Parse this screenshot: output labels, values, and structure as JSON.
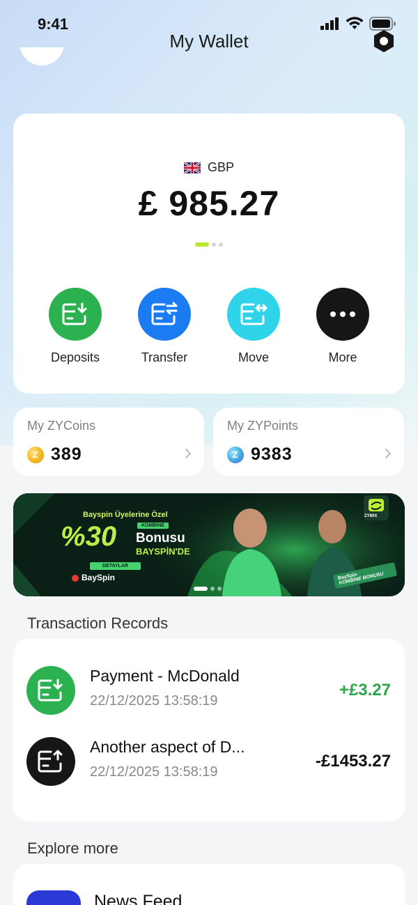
{
  "status_bar": {
    "time": "9:41"
  },
  "header": {
    "title": "My Wallet"
  },
  "balance": {
    "currency_code": "GBP",
    "amount": "£ 985.27",
    "page_indicator": {
      "count": 3,
      "active": 0
    }
  },
  "actions": [
    {
      "label": "Deposits",
      "icon": "wallet-deposit-icon",
      "color": "#2bb14f"
    },
    {
      "label": "Transfer",
      "icon": "wallet-transfer-icon",
      "color": "#1a7bf3"
    },
    {
      "label": "Move",
      "icon": "wallet-move-icon",
      "color": "#2fd3ea"
    },
    {
      "label": "More",
      "icon": "more-dots-icon",
      "color": "#161616"
    }
  ],
  "coins": {
    "title": "My ZYCoins",
    "value": "389",
    "icon": "zycoin-icon",
    "color": "#f2b41c"
  },
  "points": {
    "title": "My ZYPoints",
    "value": "9383",
    "icon": "zypoint-icon",
    "color": "#3fa9e0"
  },
  "banner": {
    "headline": "Bayspin Üyelerine Özel",
    "badge": "KOMBİNE",
    "percent": "%30",
    "bonus_word": "Bonusu",
    "site_line": "BAYSPİN'DE",
    "cta": "DETAYLAR",
    "brand": "BaySpin",
    "partner": "ZYMIX",
    "sticker_brand": "BaySpin",
    "sticker_tag": "KOMBİNE BONUSU",
    "page_indicator": {
      "count": 3,
      "active": 0
    }
  },
  "transactions": {
    "section_title": "Transaction Records",
    "items": [
      {
        "title": "Payment - McDonald",
        "date": "22/12/2025 13:58:19",
        "amount": "+£3.27",
        "type": "deposit",
        "amount_color": "#2aa84a"
      },
      {
        "title": "Another aspect of D...",
        "date": "22/12/2025 13:58:19",
        "amount": "-£1453.27",
        "type": "withdraw",
        "amount_color": "#111111"
      }
    ]
  },
  "explore": {
    "section_title": "Explore more",
    "items": [
      {
        "title": "News Feed",
        "icon_color": "#2b39d6"
      }
    ]
  }
}
